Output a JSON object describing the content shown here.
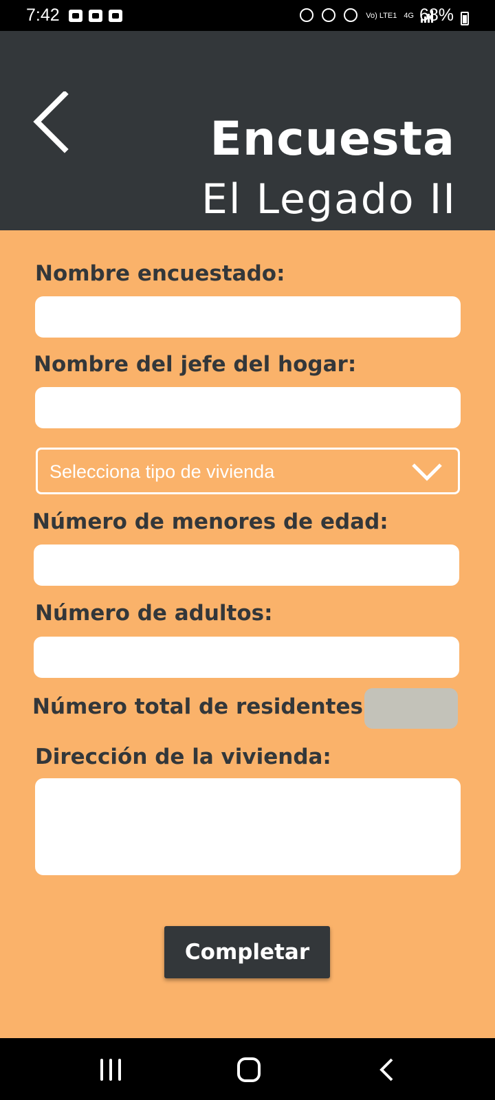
{
  "status_bar": {
    "time": "7:42",
    "battery": "68%",
    "network": "4G",
    "volte": "Vo) LTE1"
  },
  "header": {
    "title": "Encuesta",
    "subtitle": "El Legado II"
  },
  "form": {
    "respondent_label": "Nombre encuestado:",
    "respondent_value": "",
    "head_label": "Nombre del jefe del hogar:",
    "head_value": "",
    "housing_select_placeholder": "Selecciona tipo de vivienda",
    "minors_label": "Número de menores de edad:",
    "minors_value": "",
    "adults_label": "Número de adultos:",
    "adults_value": "",
    "total_label": "Número total de residentes:",
    "total_value": "",
    "address_label": "Dirección de la vivienda:",
    "address_value": "",
    "submit_label": "Completar"
  },
  "colors": {
    "header_bg": "#33373a",
    "content_bg": "#fab26a",
    "field_bg": "#ffffff",
    "disabled_field_bg": "#c3c2b9",
    "button_bg": "#33373a"
  },
  "icons": {
    "back": "chevron-left-icon",
    "dropdown": "chevron-down-icon",
    "nav_recent": "recent-apps-icon",
    "nav_home": "home-icon",
    "nav_back": "back-icon"
  }
}
